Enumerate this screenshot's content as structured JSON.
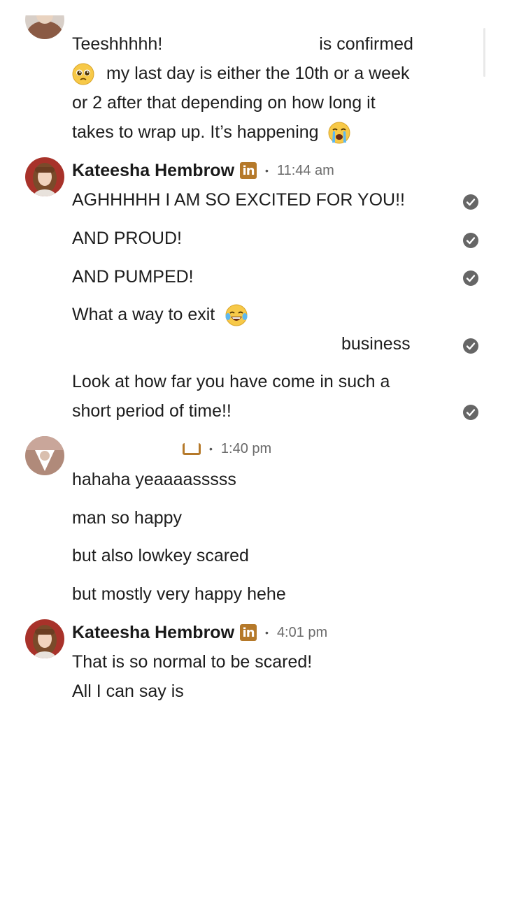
{
  "messages": [
    {
      "sender": "",
      "timestamp": "",
      "lines": [
        {
          "text_a": "Teeshhhhh!",
          "text_b": "is confirmed"
        },
        {
          "text": "my last day is either the 10th or a week",
          "emoji": "pleading-face-emoji"
        },
        {
          "text": "or 2 after that depending on how long it"
        },
        {
          "text": "takes to wrap up. It’s happening",
          "emoji": "loudly-crying-face-emoji"
        }
      ]
    },
    {
      "sender": "Kateesha Hembrow",
      "timestamp": "11:44 am",
      "lines": [
        {
          "text": "AGHHHHH I AM SO EXCITED FOR YOU!!",
          "read": true
        },
        {
          "text": "AND PROUD!",
          "read": true
        },
        {
          "text": "AND PUMPED!",
          "read": true
        },
        {
          "text": "What a way to exit",
          "emoji": "tears-of-joy-emoji"
        },
        {
          "text": "business",
          "read": true
        },
        {
          "text": "Look at how far you have come in such a"
        },
        {
          "text": "short period of time!!",
          "read": true
        }
      ]
    },
    {
      "sender": "",
      "timestamp": "1:40 pm",
      "lines": [
        {
          "text": "hahaha yeaaaasssss"
        },
        {
          "text": "man so happy"
        },
        {
          "text": "but also lowkey scared"
        },
        {
          "text": "but mostly very happy hehe"
        }
      ]
    },
    {
      "sender": "Kateesha Hembrow",
      "timestamp": "4:01 pm",
      "lines": [
        {
          "text": "That is so normal to be scared!"
        },
        {
          "text": "All I can say is"
        }
      ]
    }
  ],
  "icons": {
    "linkedin_badge": "in",
    "read_receipt": "check-circle-icon"
  },
  "colors": {
    "linkedin_badge": "#b5792a",
    "read_receipt": "#666666",
    "timestamp": "#6b6b6b"
  }
}
